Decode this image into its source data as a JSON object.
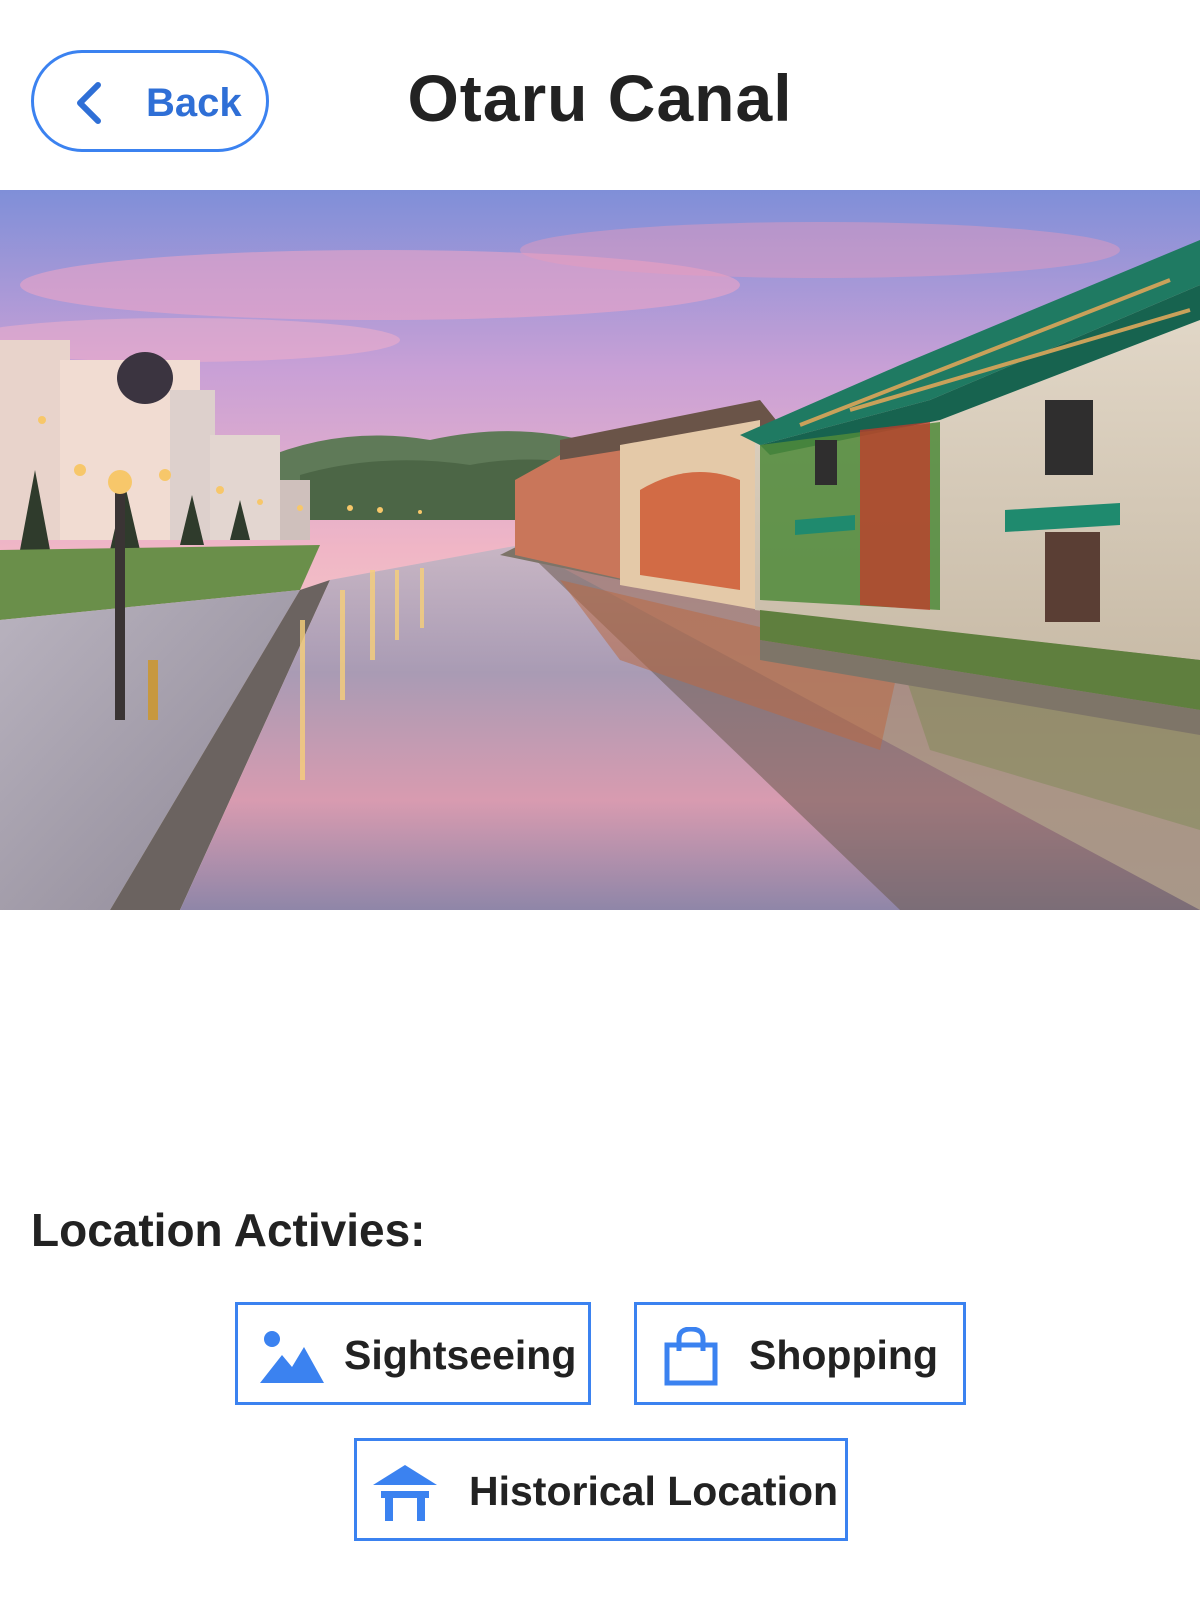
{
  "header": {
    "back_label": "Back",
    "title": "Otaru Canal"
  },
  "hero": {
    "image_subject": "Otaru Canal at dusk with warehouses and street lamps"
  },
  "activities": {
    "title": "Location Activies:",
    "items": [
      {
        "label": "Sightseeing",
        "icon": "mountain-icon"
      },
      {
        "label": "Shopping",
        "icon": "shopping-bag-icon"
      },
      {
        "label": "Historical Location",
        "icon": "temple-icon"
      }
    ]
  },
  "colors": {
    "accent": "#3b82f0",
    "accent_text": "#2f6fd6",
    "text": "#222222",
    "background": "#ffffff"
  }
}
